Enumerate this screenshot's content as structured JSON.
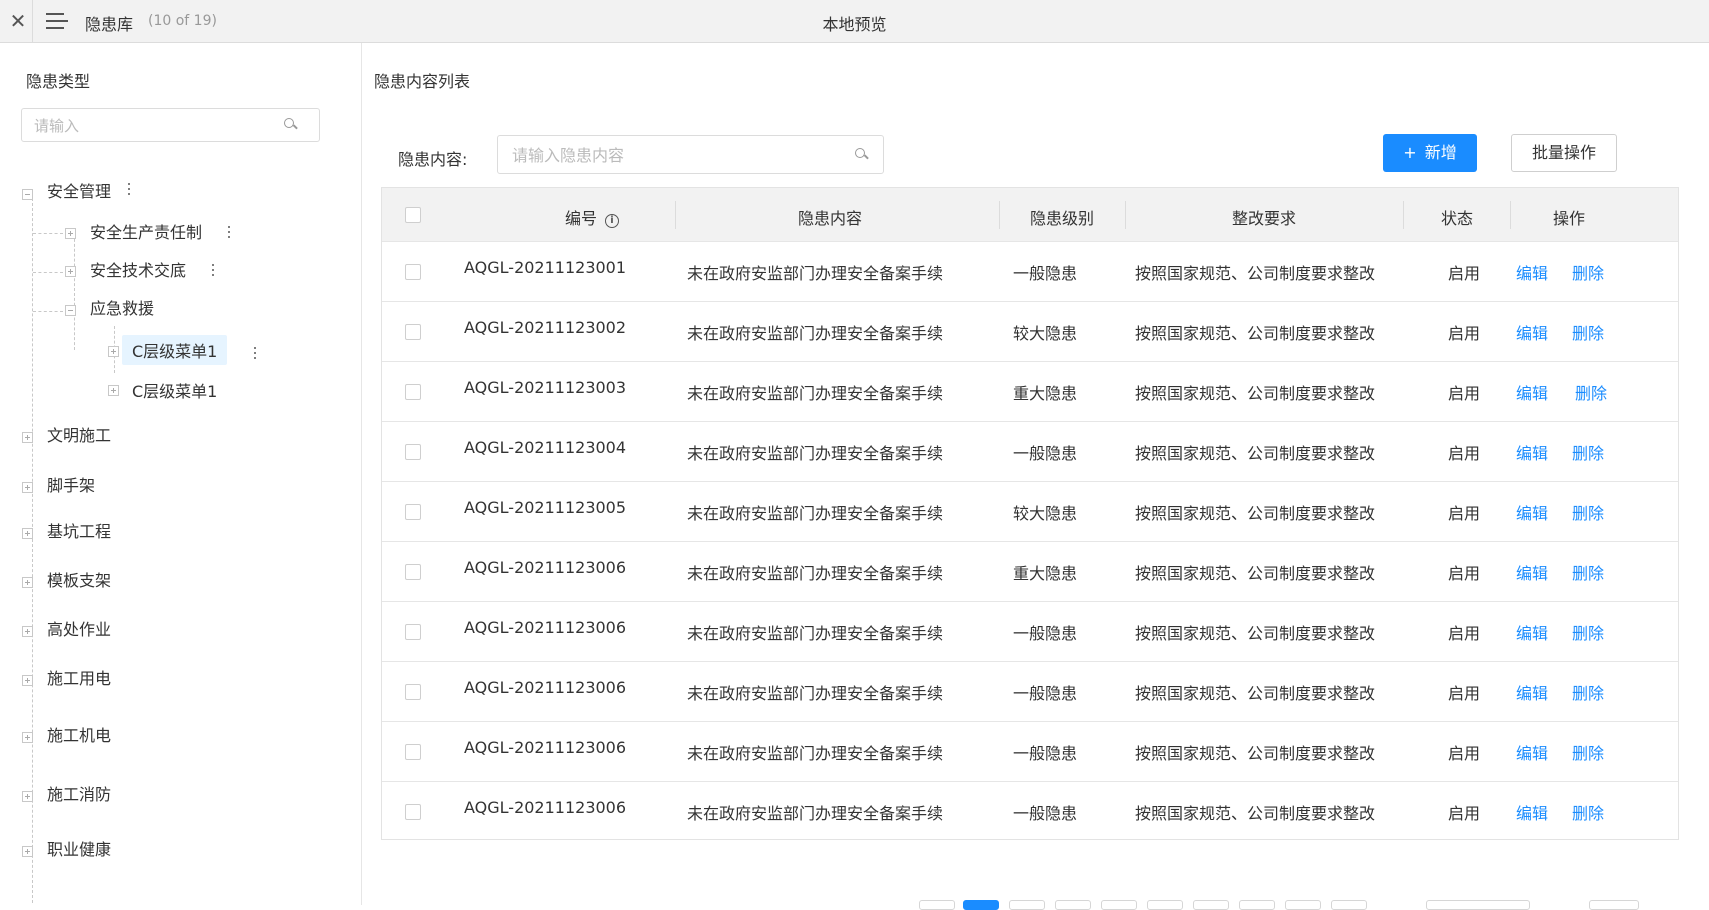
{
  "topbar": {
    "app_title": "隐患库",
    "count": "(10 of 19)",
    "window_title": "本地预览"
  },
  "sidebar": {
    "title": "隐患类型",
    "search_placeholder": "请输入",
    "tree": {
      "root": "安全管理",
      "children": [
        "安全生产责任制",
        "安全技术交底",
        "应急救援"
      ],
      "grandchildren": [
        "C层级菜单1",
        "C层级菜单1"
      ],
      "others": [
        "文明施工",
        "脚手架",
        "基坑工程",
        "模板支架",
        "高处作业",
        "施工用电",
        "施工机电",
        "施工消防",
        "职业健康"
      ]
    }
  },
  "main": {
    "title": "隐患内容列表",
    "filter_label": "隐患内容:",
    "filter_placeholder": "请输入隐患内容",
    "add_label": "新增",
    "batch_label": "批量操作"
  },
  "table": {
    "headers": [
      "编号",
      "隐患内容",
      "隐患级别",
      "整改要求",
      "状态",
      "操作"
    ],
    "edit_label": "编辑",
    "delete_label": "删除",
    "rows": [
      {
        "id": "AQGL-20211123001",
        "content": "未在政府安监部门办理安全备案手续",
        "level": "一般隐患",
        "req": "按照国家规范、公司制度要求整改",
        "status": "启用"
      },
      {
        "id": "AQGL-20211123002",
        "content": "未在政府安监部门办理安全备案手续",
        "level": "较大隐患",
        "req": "按照国家规范、公司制度要求整改",
        "status": "启用"
      },
      {
        "id": "AQGL-20211123003",
        "content": "未在政府安监部门办理安全备案手续",
        "level": "重大隐患",
        "req": "按照国家规范、公司制度要求整改",
        "status": "启用"
      },
      {
        "id": "AQGL-20211123004",
        "content": "未在政府安监部门办理安全备案手续",
        "level": "一般隐患",
        "req": "按照国家规范、公司制度要求整改",
        "status": "启用"
      },
      {
        "id": "AQGL-20211123005",
        "content": "未在政府安监部门办理安全备案手续",
        "level": "较大隐患",
        "req": "按照国家规范、公司制度要求整改",
        "status": "启用"
      },
      {
        "id": "AQGL-20211123006",
        "content": "未在政府安监部门办理安全备案手续",
        "level": "重大隐患",
        "req": "按照国家规范、公司制度要求整改",
        "status": "启用"
      },
      {
        "id": "AQGL-20211123006",
        "content": "未在政府安监部门办理安全备案手续",
        "level": "一般隐患",
        "req": "按照国家规范、公司制度要求整改",
        "status": "启用"
      },
      {
        "id": "AQGL-20211123006",
        "content": "未在政府安监部门办理安全备案手续",
        "level": "一般隐患",
        "req": "按照国家规范、公司制度要求整改",
        "status": "启用"
      },
      {
        "id": "AQGL-20211123006",
        "content": "未在政府安监部门办理安全备案手续",
        "level": "一般隐患",
        "req": "按照国家规范、公司制度要求整改",
        "status": "启用"
      },
      {
        "id": "AQGL-20211123006",
        "content": "未在政府安监部门办理安全备案手续",
        "level": "一般隐患",
        "req": "按照国家规范、公司制度要求整改",
        "status": "启用"
      }
    ]
  },
  "colors": {
    "accent": "#1a8cff",
    "header_bg": "#f2f2f2",
    "selected_bg": "#e6f4ff"
  }
}
